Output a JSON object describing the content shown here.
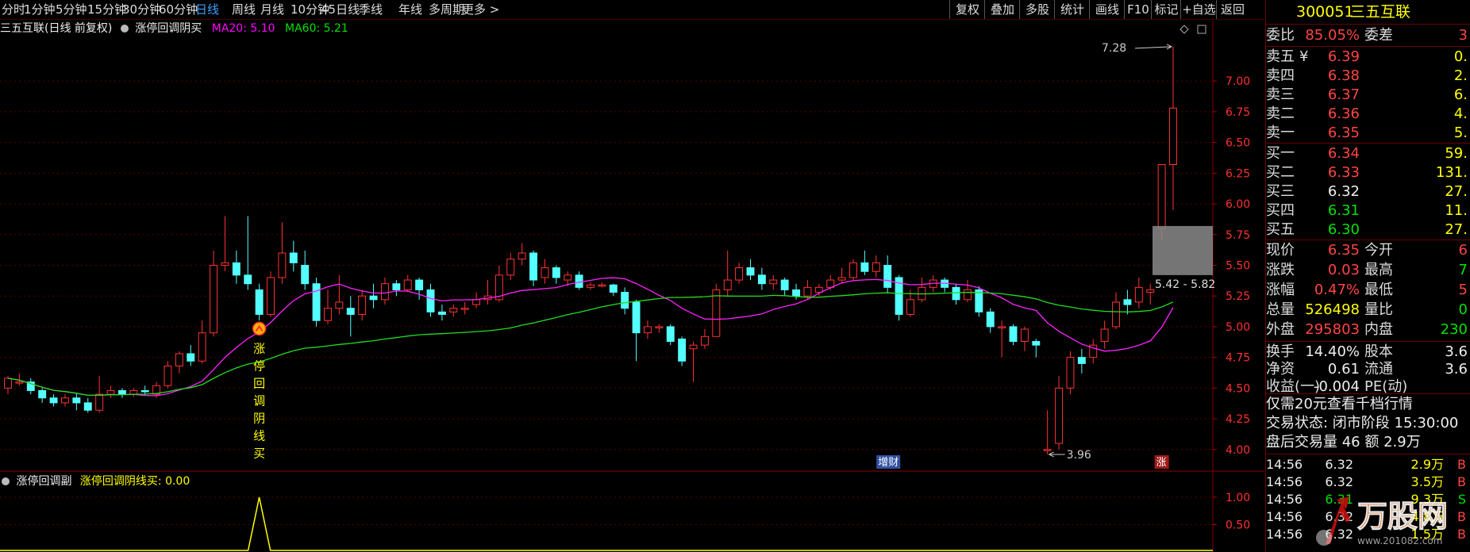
{
  "toolbar": {
    "periods": [
      "分时",
      "1分钟",
      "5分钟",
      "15分钟",
      "30分钟",
      "60分钟",
      "日线",
      "周线",
      "月线",
      "10分钟",
      "45日线",
      "季线",
      "年线",
      "多周期",
      "更多 >"
    ],
    "active_period": "日线",
    "buttons": [
      "复权",
      "叠加",
      "多股",
      "统计",
      "画线",
      "F10",
      "标记",
      "+自选",
      "返回"
    ]
  },
  "chart_header": {
    "stock_label": "三五互联(日线 前复权)",
    "indicator_icon": "circle-icon",
    "indicator_name": "涨停回调阴买",
    "ma20": "MA20: 5.10",
    "ma60": "MA60: 5.21"
  },
  "chart_data": {
    "type": "candlestick",
    "y_ticks": [
      "7.00",
      "6.75",
      "6.50",
      "6.25",
      "6.00",
      "5.75",
      "5.50",
      "5.25",
      "5.00",
      "4.75",
      "4.50",
      "4.25",
      "4.00"
    ],
    "ylim": [
      3.85,
      7.35
    ],
    "annotations": {
      "high": "7.28",
      "low": "3.96",
      "range": "5.42 - 5.82"
    },
    "signal_text": "涨停回调阴线买",
    "markers": [
      "增财",
      "涨"
    ],
    "candles": [
      [
        4.5,
        4.58,
        4.6,
        4.45
      ],
      [
        4.55,
        4.55,
        4.62,
        4.52
      ],
      [
        4.55,
        4.48,
        4.58,
        4.45
      ],
      [
        4.48,
        4.42,
        4.5,
        4.38
      ],
      [
        4.42,
        4.38,
        4.45,
        4.35
      ],
      [
        4.38,
        4.42,
        4.45,
        4.35
      ],
      [
        4.42,
        4.38,
        4.46,
        4.32
      ],
      [
        4.38,
        4.32,
        4.42,
        4.3
      ],
      [
        4.32,
        4.45,
        4.6,
        4.3
      ],
      [
        4.45,
        4.48,
        4.52,
        4.42
      ],
      [
        4.48,
        4.45,
        4.5,
        4.42
      ],
      [
        4.45,
        4.48,
        4.5,
        4.43
      ],
      [
        4.48,
        4.47,
        4.52,
        4.44
      ],
      [
        4.45,
        4.52,
        4.55,
        4.42
      ],
      [
        4.52,
        4.68,
        4.72,
        4.5
      ],
      [
        4.68,
        4.78,
        4.8,
        4.62
      ],
      [
        4.78,
        4.72,
        4.85,
        4.68
      ],
      [
        4.72,
        4.95,
        5.05,
        4.7
      ],
      [
        4.95,
        5.5,
        5.62,
        4.92
      ],
      [
        5.5,
        5.52,
        5.9,
        5.45
      ],
      [
        5.52,
        5.42,
        5.62,
        5.35
      ],
      [
        5.42,
        5.35,
        5.9,
        5.3
      ],
      [
        5.3,
        5.1,
        5.35,
        5.05
      ],
      [
        5.1,
        5.4,
        5.45,
        5.08
      ],
      [
        5.4,
        5.6,
        5.85,
        5.35
      ],
      [
        5.6,
        5.52,
        5.7,
        5.45
      ],
      [
        5.5,
        5.35,
        5.62,
        5.3
      ],
      [
        5.35,
        5.05,
        5.4,
        5.0
      ],
      [
        5.05,
        5.15,
        5.3,
        5.02
      ],
      [
        5.15,
        5.2,
        5.42,
        5.1
      ],
      [
        5.15,
        5.1,
        5.25,
        4.92
      ],
      [
        5.1,
        5.25,
        5.3,
        5.05
      ],
      [
        5.25,
        5.22,
        5.35,
        5.15
      ],
      [
        5.22,
        5.35,
        5.4,
        5.18
      ],
      [
        5.35,
        5.3,
        5.38,
        5.25
      ],
      [
        5.3,
        5.38,
        5.42,
        5.28
      ],
      [
        5.38,
        5.3,
        5.4,
        5.22
      ],
      [
        5.3,
        5.12,
        5.35,
        5.08
      ],
      [
        5.12,
        5.1,
        5.18,
        5.05
      ],
      [
        5.12,
        5.15,
        5.18,
        5.08
      ],
      [
        5.15,
        5.15,
        5.2,
        5.1
      ],
      [
        5.18,
        5.22,
        5.28,
        5.15
      ],
      [
        5.22,
        5.25,
        5.38,
        5.18
      ],
      [
        5.22,
        5.42,
        5.5,
        5.2
      ],
      [
        5.42,
        5.55,
        5.6,
        5.38
      ],
      [
        5.55,
        5.6,
        5.68,
        5.5
      ],
      [
        5.6,
        5.38,
        5.62,
        5.33
      ],
      [
        5.4,
        5.48,
        5.55,
        5.35
      ],
      [
        5.48,
        5.4,
        5.5,
        5.35
      ],
      [
        5.38,
        5.42,
        5.45,
        5.33
      ],
      [
        5.42,
        5.32,
        5.45,
        5.3
      ],
      [
        5.32,
        5.34,
        5.36,
        5.3
      ],
      [
        5.34,
        5.34,
        5.36,
        5.32
      ],
      [
        5.34,
        5.28,
        5.35,
        5.25
      ],
      [
        5.28,
        5.15,
        5.32,
        5.1
      ],
      [
        5.2,
        4.95,
        5.22,
        4.72
      ],
      [
        4.95,
        5.0,
        5.05,
        4.9
      ],
      [
        5.0,
        5.0,
        5.02,
        4.95
      ],
      [
        5.0,
        4.88,
        5.02,
        4.85
      ],
      [
        4.9,
        4.72,
        4.92,
        4.68
      ],
      [
        4.82,
        4.85,
        4.88,
        4.55
      ],
      [
        4.85,
        4.92,
        4.98,
        4.82
      ],
      [
        4.92,
        5.3,
        5.35,
        4.92
      ],
      [
        5.3,
        5.38,
        5.62,
        5.25
      ],
      [
        5.38,
        5.48,
        5.52,
        5.35
      ],
      [
        5.48,
        5.42,
        5.55,
        5.38
      ],
      [
        5.42,
        5.35,
        5.48,
        5.3
      ],
      [
        5.35,
        5.38,
        5.42,
        5.3
      ],
      [
        5.38,
        5.3,
        5.4,
        5.25
      ],
      [
        5.3,
        5.25,
        5.35,
        5.22
      ],
      [
        5.25,
        5.32,
        5.38,
        5.22
      ],
      [
        5.28,
        5.32,
        5.35,
        5.25
      ],
      [
        5.32,
        5.38,
        5.42,
        5.3
      ],
      [
        5.38,
        5.4,
        5.48,
        5.35
      ],
      [
        5.4,
        5.52,
        5.55,
        5.38
      ],
      [
        5.52,
        5.45,
        5.62,
        5.42
      ],
      [
        5.45,
        5.52,
        5.58,
        5.4
      ],
      [
        5.5,
        5.32,
        5.58,
        5.28
      ],
      [
        5.4,
        5.1,
        5.42,
        5.05
      ],
      [
        5.1,
        5.22,
        5.3,
        5.08
      ],
      [
        5.22,
        5.32,
        5.4,
        5.2
      ],
      [
        5.32,
        5.38,
        5.42,
        5.28
      ],
      [
        5.38,
        5.32,
        5.4,
        5.28
      ],
      [
        5.32,
        5.22,
        5.35,
        5.18
      ],
      [
        5.22,
        5.3,
        5.38,
        5.2
      ],
      [
        5.3,
        5.12,
        5.33,
        5.08
      ],
      [
        5.12,
        5.0,
        5.15,
        4.95
      ],
      [
        5.0,
        5.0,
        5.05,
        4.75
      ],
      [
        5.0,
        4.88,
        5.02,
        4.85
      ],
      [
        4.88,
        4.98,
        5.0,
        4.8
      ],
      [
        4.88,
        4.85,
        4.9,
        4.75
      ],
      [
        4.0,
        4.0,
        4.32,
        3.96
      ],
      [
        4.05,
        4.5,
        4.6,
        4.0
      ],
      [
        4.5,
        4.75,
        4.8,
        4.45
      ],
      [
        4.75,
        4.7,
        4.82,
        4.62
      ],
      [
        4.75,
        4.85,
        4.9,
        4.7
      ],
      [
        4.88,
        4.98,
        5.05,
        4.82
      ],
      [
        5.0,
        5.2,
        5.28,
        4.98
      ],
      [
        5.22,
        5.18,
        5.3,
        5.1
      ],
      [
        5.2,
        5.32,
        5.4,
        5.15
      ],
      [
        5.28,
        5.3,
        5.35,
        5.18
      ],
      [
        5.8,
        6.32,
        6.32,
        5.7
      ],
      [
        6.32,
        6.78,
        7.28,
        5.95
      ]
    ]
  },
  "sub_chart": {
    "name": "涨停回调副",
    "signal_label": "涨停回调阴线买: 0.00",
    "y_ticks": [
      "1.00",
      "0.50"
    ]
  },
  "panel": {
    "code": "300051",
    "name": "三五互联",
    "weibi_label": "委比",
    "weibi_value": "85.05%",
    "weicha_label": "委差",
    "weicha_value": "3",
    "asks": [
      {
        "label": "卖五",
        "price": "6.39",
        "vol": "0."
      },
      {
        "label": "卖四",
        "price": "6.38",
        "vol": "2."
      },
      {
        "label": "卖三",
        "price": "6.37",
        "vol": "6."
      },
      {
        "label": "卖二",
        "price": "6.36",
        "vol": "4."
      },
      {
        "label": "卖一",
        "price": "6.35",
        "vol": "5."
      }
    ],
    "bids": [
      {
        "label": "买一",
        "price": "6.34",
        "vol": "59."
      },
      {
        "label": "买二",
        "price": "6.33",
        "vol": "131."
      },
      {
        "label": "买三",
        "price": "6.32",
        "vol": "27."
      },
      {
        "label": "买四",
        "price": "6.31",
        "vol": "11."
      },
      {
        "label": "买五",
        "price": "6.30",
        "vol": "27."
      }
    ],
    "stats": [
      {
        "l1": "现价",
        "v1": "6.35",
        "l2": "今开",
        "v2": "6"
      },
      {
        "l1": "涨跌",
        "v1": "0.03",
        "l2": "最高",
        "v2": "7"
      },
      {
        "l1": "涨幅",
        "v1": "0.47%",
        "l2": "最低",
        "v2": "5"
      },
      {
        "l1": "总量",
        "v1": "526498",
        "l2": "量比",
        "v2": "0"
      },
      {
        "l1": "外盘",
        "v1": "295803",
        "l2": "内盘",
        "v2": "230"
      }
    ],
    "stats2": [
      {
        "l1": "换手",
        "v1": "14.40%",
        "l2": "股本",
        "v2": "3.6"
      },
      {
        "l1": "净资",
        "v1": "0.61",
        "l2": "流通",
        "v2": "3.6"
      },
      {
        "l1": "收益(一)",
        "v1": "-0.004",
        "l2": "PE(动)",
        "v2": ""
      }
    ],
    "promo": "仅需20元查看千档行情",
    "trade_status": "交易状态: 闭市阶段 15:30:00",
    "after_hours": "盘后交易量 46 额 2.9万",
    "ticks": [
      {
        "t": "14:56",
        "p": "6.32",
        "v": "2.9万",
        "s": "B"
      },
      {
        "t": "14:56",
        "p": "6.32",
        "v": "3.5万",
        "s": "B"
      },
      {
        "t": "14:56",
        "p": "6.31",
        "v": "9.3万",
        "s": "S"
      },
      {
        "t": "14:56",
        "p": "6.32",
        "v": "4.8万",
        "s": "B"
      },
      {
        "t": "14:56",
        "p": "6.32",
        "v": "1.5万",
        "s": "B"
      }
    ]
  },
  "watermark": {
    "text": "万股网",
    "url": "www.201082.com"
  }
}
